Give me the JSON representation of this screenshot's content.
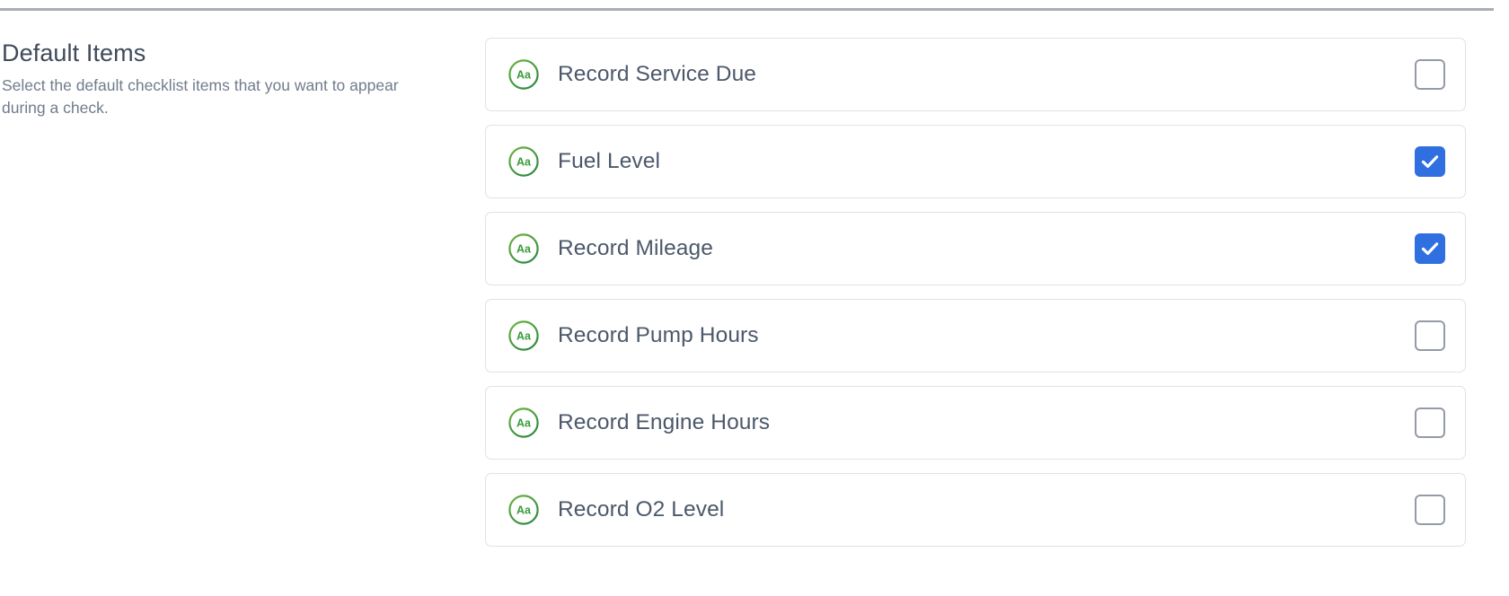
{
  "section": {
    "title": "Default Items",
    "description": "Select the default checklist items that you want to appear during a check."
  },
  "colors": {
    "accent_checked": "#2f6fe0",
    "icon_green": "#3a9b3a",
    "heading_text": "#3f4a5a",
    "body_text": "#707c8c",
    "row_text": "#4c586a",
    "row_border": "#dfe2e8",
    "divider": "#a8adb6",
    "checkbox_border": "#949aa6",
    "background": "#ffffff"
  },
  "checklist": {
    "icon_name": "aa-text-field-icon",
    "icon_label": "Aa",
    "items": [
      {
        "label": "Record Service Due",
        "checked": false
      },
      {
        "label": "Fuel Level",
        "checked": true
      },
      {
        "label": "Record Mileage",
        "checked": true
      },
      {
        "label": "Record Pump Hours",
        "checked": false
      },
      {
        "label": "Record Engine Hours",
        "checked": false
      },
      {
        "label": "Record O2 Level",
        "checked": false
      }
    ]
  }
}
